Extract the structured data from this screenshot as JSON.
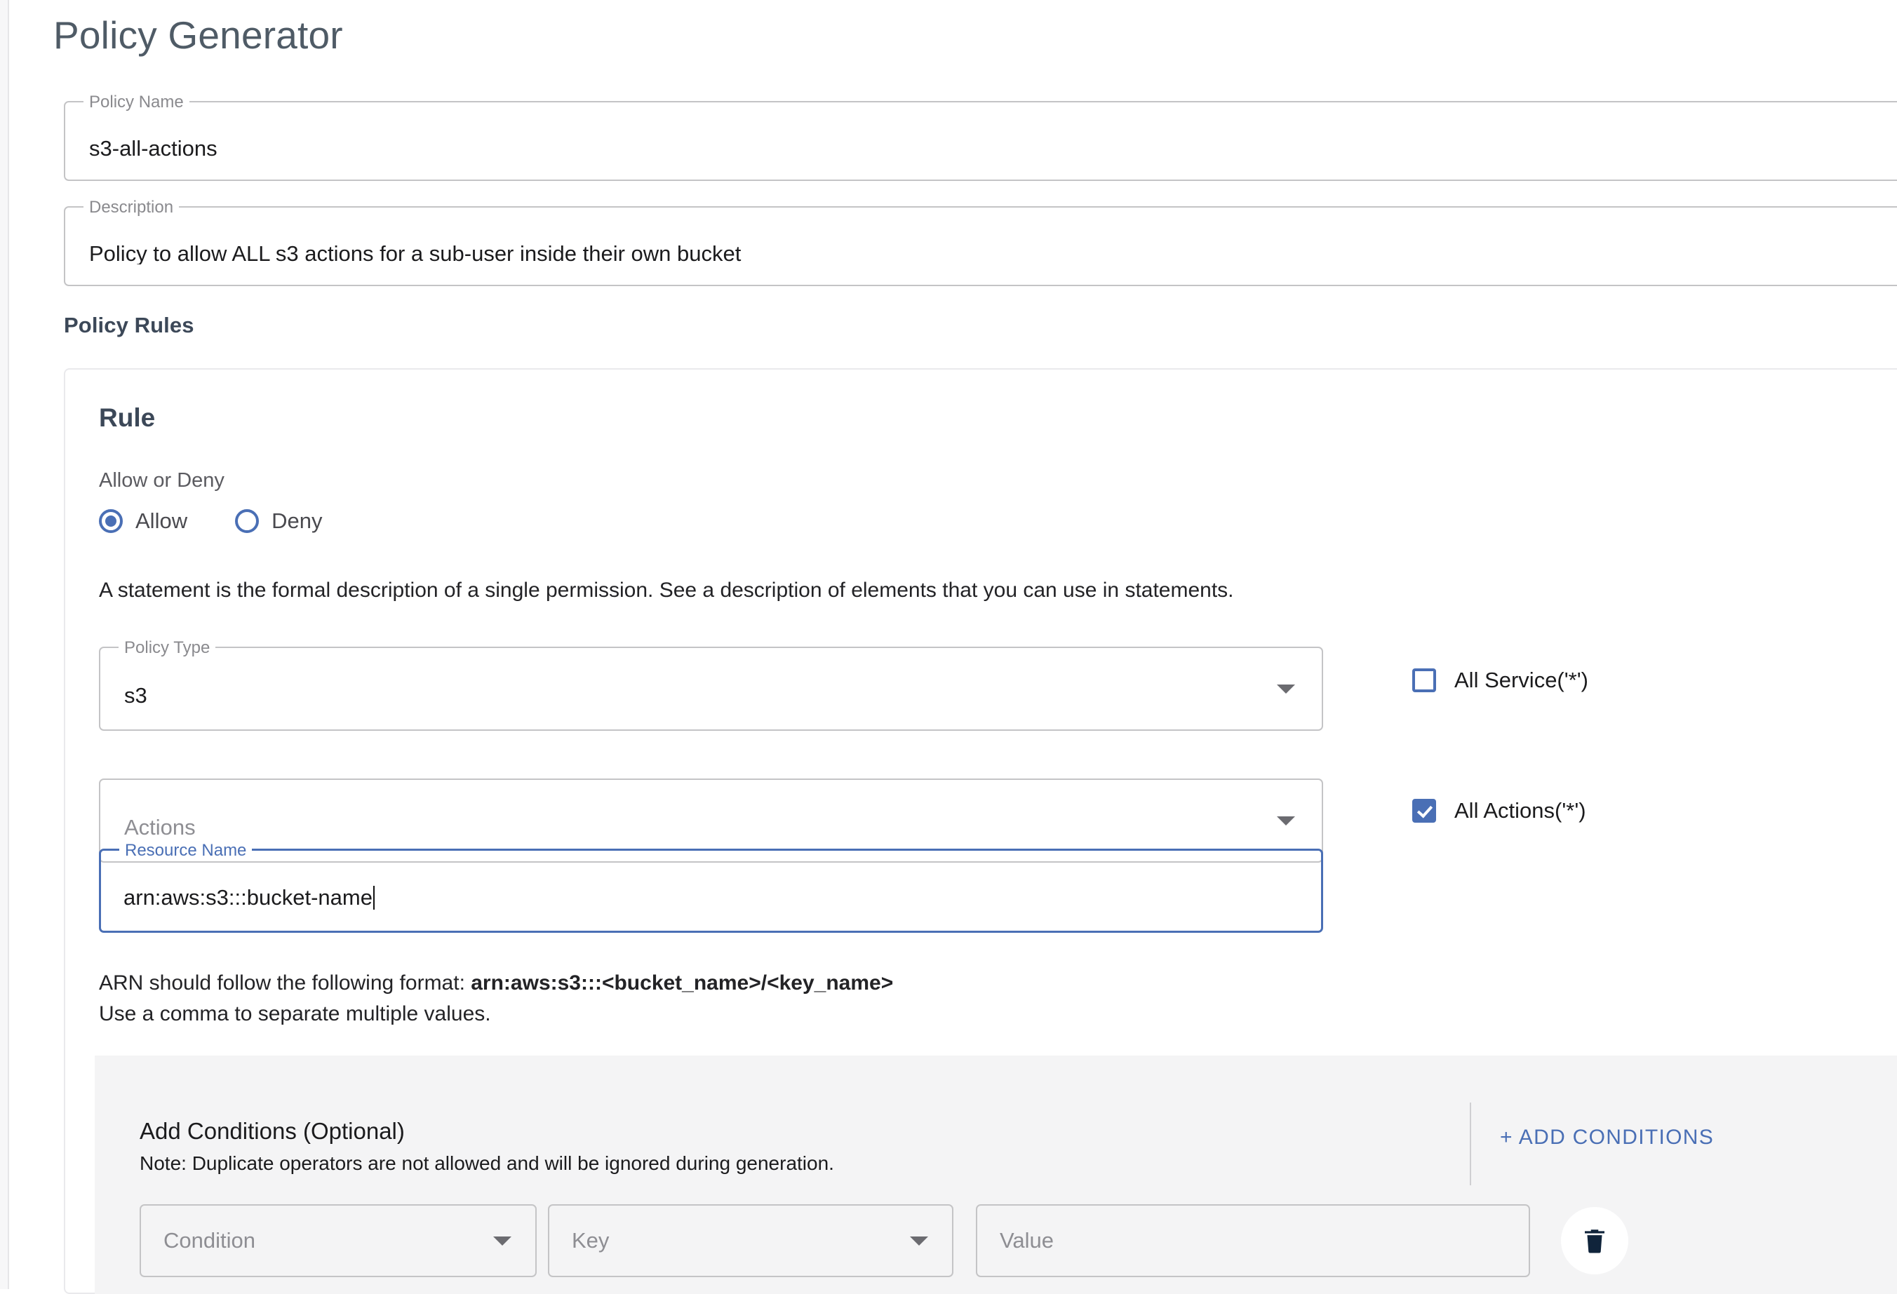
{
  "page": {
    "title": "Policy Generator"
  },
  "policy_name": {
    "label": "Policy Name",
    "value": "s3-all-actions"
  },
  "description": {
    "label": "Description",
    "value": "Policy to allow ALL s3 actions for a sub-user inside their own bucket"
  },
  "policy_rules": {
    "heading": "Policy Rules",
    "rule": {
      "title": "Rule",
      "allow_deny_label": "Allow or Deny",
      "options": [
        {
          "label": "Allow",
          "selected": true
        },
        {
          "label": "Deny",
          "selected": false
        }
      ],
      "statement_note": "A statement is the formal description of a single permission. See a description of elements that you can use in statements.",
      "policy_type": {
        "label": "Policy Type",
        "value": "s3",
        "icon": "chevron-down-icon"
      },
      "all_service": {
        "label": "All Service('*')",
        "checked": false
      },
      "actions": {
        "label": "Actions",
        "placeholder": "Actions",
        "icon": "chevron-down-icon"
      },
      "all_actions": {
        "label": "All Actions('*')",
        "checked": true
      },
      "resource_name": {
        "label": "Resource Name",
        "value": "arn:aws:s3:::bucket-name",
        "spell_part": "arn:aws:s3:",
        "rest_part": "::bucket-name",
        "focused": true
      },
      "arn_hint_line1_prefix": "ARN should follow the following format: ",
      "arn_hint_line1_bold": "arn:aws:s3:::<bucket_name>/<key_name>",
      "arn_hint_line2": "Use a comma to separate multiple values.",
      "conditions": {
        "title": "Add Conditions (Optional)",
        "note": "Note: Duplicate operators are not allowed and will be ignored during generation.",
        "add_button": "+ ADD CONDITIONS",
        "condition_placeholder": "Condition",
        "key_placeholder": "Key",
        "value_placeholder": "Value",
        "delete_icon": "trash-icon"
      }
    }
  },
  "colors": {
    "accent": "#4a6fb5",
    "title": "#4f5b66",
    "heading": "#3c4858",
    "border": "#c4c4c6",
    "panel_bg": "#f4f4f5",
    "spell_error": "#e55b4c"
  }
}
